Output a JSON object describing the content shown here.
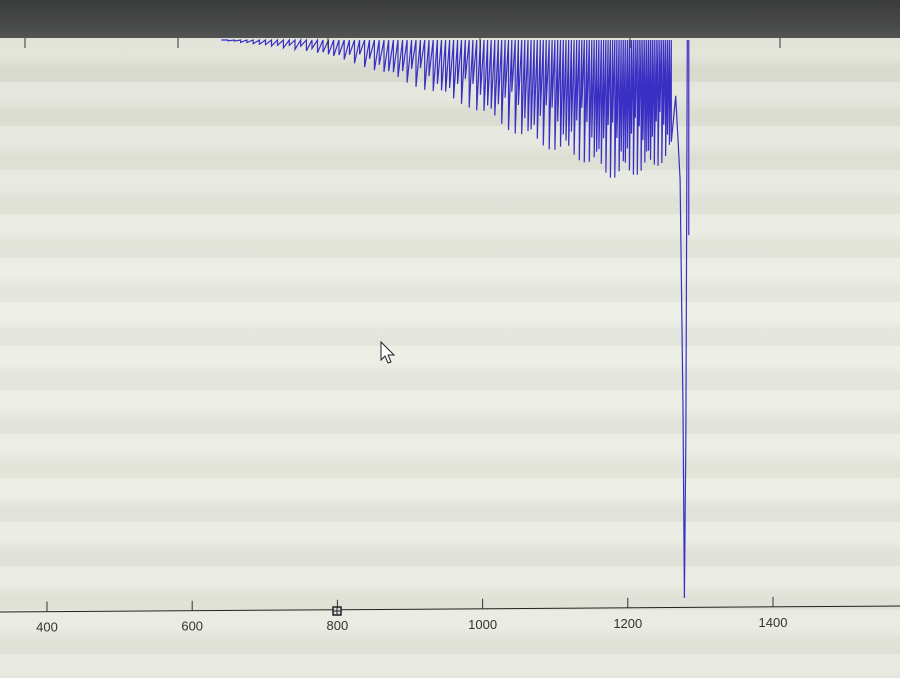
{
  "chart_data": {
    "type": "line",
    "title": "",
    "xlabel": "",
    "ylabel": "",
    "xlim": [
      320,
      1570
    ],
    "ylim": [
      -1.0,
      0.0
    ],
    "x_ticks": [
      400,
      600,
      800,
      1000,
      1200,
      1400
    ],
    "x_tick_labels": [
      "400",
      "600",
      "800",
      "1000",
      "1200",
      "1400"
    ],
    "grid": false,
    "series": [
      {
        "color": "#3a2fc4",
        "x": [
          640,
          700,
          760,
          820,
          860,
          900,
          940,
          980,
          1020,
          1060,
          1100,
          1140,
          1180,
          1220,
          1250,
          1265,
          1272,
          1276,
          1278,
          1280,
          1282
        ],
        "y": [
          0.0,
          -0.01,
          -0.02,
          -0.04,
          -0.06,
          -0.08,
          -0.1,
          -0.12,
          -0.15,
          -0.18,
          -0.2,
          -0.22,
          -0.25,
          -0.24,
          -0.22,
          -0.2,
          -0.3,
          -0.6,
          -1.0,
          -0.7,
          0.0
        ]
      }
    ]
  }
}
